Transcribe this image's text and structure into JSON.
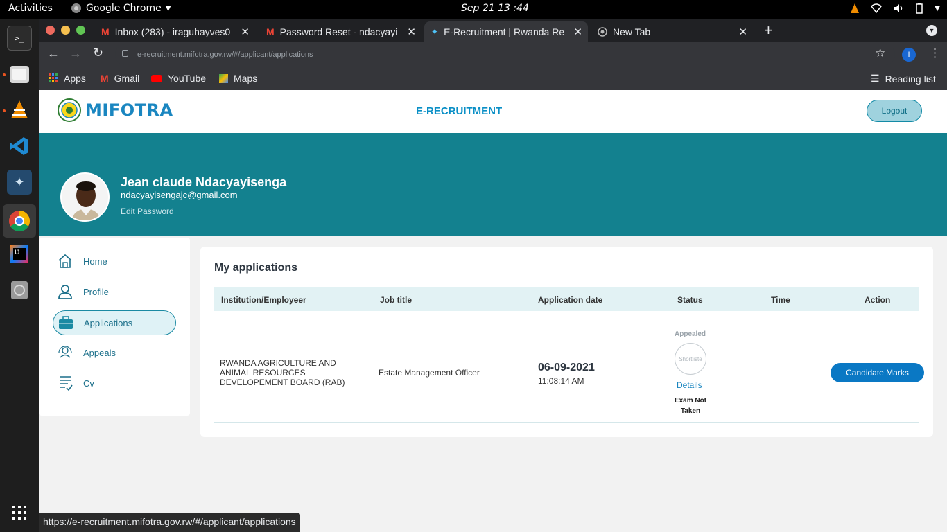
{
  "system": {
    "activities": "Activities",
    "app_name": "Google Chrome",
    "clock": "Sep 21  13 :44"
  },
  "browser": {
    "tabs": [
      {
        "title": "Inbox (283) - iraguhayves0",
        "icon": "gmail-icon"
      },
      {
        "title": "Password Reset - ndacyayi",
        "icon": "gmail-icon"
      },
      {
        "title": "E-Recruitment | Rwanda Re",
        "icon": "site-icon"
      },
      {
        "title": "New Tab",
        "icon": "chrome-icon"
      }
    ],
    "url": "e-recruitment.mifotra.gov.rw/#/applicant/applications",
    "profile_initial": "I",
    "bookmarks": [
      {
        "label": "Apps",
        "icon": "apps-grid-icon"
      },
      {
        "label": "Gmail",
        "icon": "gmail-icon"
      },
      {
        "label": "YouTube",
        "icon": "youtube-icon"
      },
      {
        "label": "Maps",
        "icon": "maps-icon"
      }
    ],
    "reading_list": "Reading list",
    "status_url": "https://e-recruitment.mifotra.gov.rw/#/applicant/applications"
  },
  "site": {
    "logo_text": "MIFOTRA",
    "title": "E-RECRUITMENT",
    "logout": "Logout"
  },
  "profile": {
    "name": "Jean claude Ndacyayisenga",
    "email": "ndacyayisengajc@gmail.com",
    "edit_password": "Edit Password"
  },
  "sidebar": {
    "items": [
      {
        "label": "Home",
        "icon": "home-icon"
      },
      {
        "label": "Profile",
        "icon": "user-icon"
      },
      {
        "label": "Applications",
        "icon": "briefcase-icon",
        "active": true
      },
      {
        "label": "Appeals",
        "icon": "appeal-icon"
      },
      {
        "label": "Cv",
        "icon": "cv-icon"
      }
    ]
  },
  "applications": {
    "title": "My applications",
    "columns": [
      "Institution/Employeer",
      "Job title",
      "Application date",
      "Status",
      "Time",
      "Action"
    ],
    "row": {
      "institution": "RWANDA AGRICULTURE AND ANIMAL RESOURCES DEVELOPEMENT BOARD (RAB)",
      "job_title": "Estate Management Officer",
      "date": "06-09-2021",
      "time": "11:08:14 AM",
      "status_top": "Appealed",
      "status_circle": "Shortliste",
      "details": "Details",
      "exam_status": "Exam Not Taken",
      "action": "Candidate Marks"
    }
  },
  "colors": {
    "banner": "#13818f",
    "accent": "#0a78c4",
    "brand": "#1a86c0"
  }
}
